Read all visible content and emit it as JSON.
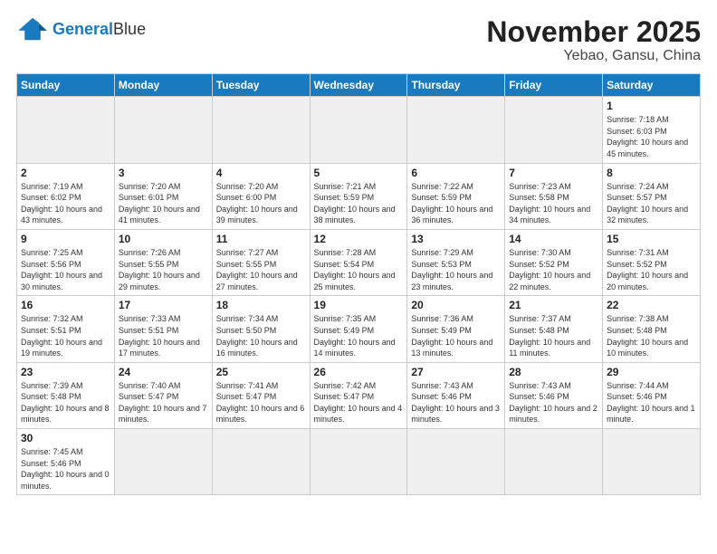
{
  "header": {
    "logo_general": "General",
    "logo_blue": "Blue",
    "month_title": "November 2025",
    "location": "Yebao, Gansu, China"
  },
  "days_of_week": [
    "Sunday",
    "Monday",
    "Tuesday",
    "Wednesday",
    "Thursday",
    "Friday",
    "Saturday"
  ],
  "weeks": [
    [
      {
        "day": "",
        "empty": true
      },
      {
        "day": "",
        "empty": true
      },
      {
        "day": "",
        "empty": true
      },
      {
        "day": "",
        "empty": true
      },
      {
        "day": "",
        "empty": true
      },
      {
        "day": "",
        "empty": true
      },
      {
        "day": "1",
        "sunrise": "7:18 AM",
        "sunset": "6:03 PM",
        "daylight": "10 hours and 45 minutes."
      }
    ],
    [
      {
        "day": "2",
        "sunrise": "7:19 AM",
        "sunset": "6:02 PM",
        "daylight": "10 hours and 43 minutes."
      },
      {
        "day": "3",
        "sunrise": "7:20 AM",
        "sunset": "6:01 PM",
        "daylight": "10 hours and 41 minutes."
      },
      {
        "day": "4",
        "sunrise": "7:20 AM",
        "sunset": "6:00 PM",
        "daylight": "10 hours and 39 minutes."
      },
      {
        "day": "5",
        "sunrise": "7:21 AM",
        "sunset": "5:59 PM",
        "daylight": "10 hours and 38 minutes."
      },
      {
        "day": "6",
        "sunrise": "7:22 AM",
        "sunset": "5:59 PM",
        "daylight": "10 hours and 36 minutes."
      },
      {
        "day": "7",
        "sunrise": "7:23 AM",
        "sunset": "5:58 PM",
        "daylight": "10 hours and 34 minutes."
      },
      {
        "day": "8",
        "sunrise": "7:24 AM",
        "sunset": "5:57 PM",
        "daylight": "10 hours and 32 minutes."
      }
    ],
    [
      {
        "day": "9",
        "sunrise": "7:25 AM",
        "sunset": "5:56 PM",
        "daylight": "10 hours and 30 minutes."
      },
      {
        "day": "10",
        "sunrise": "7:26 AM",
        "sunset": "5:55 PM",
        "daylight": "10 hours and 29 minutes."
      },
      {
        "day": "11",
        "sunrise": "7:27 AM",
        "sunset": "5:55 PM",
        "daylight": "10 hours and 27 minutes."
      },
      {
        "day": "12",
        "sunrise": "7:28 AM",
        "sunset": "5:54 PM",
        "daylight": "10 hours and 25 minutes."
      },
      {
        "day": "13",
        "sunrise": "7:29 AM",
        "sunset": "5:53 PM",
        "daylight": "10 hours and 23 minutes."
      },
      {
        "day": "14",
        "sunrise": "7:30 AM",
        "sunset": "5:52 PM",
        "daylight": "10 hours and 22 minutes."
      },
      {
        "day": "15",
        "sunrise": "7:31 AM",
        "sunset": "5:52 PM",
        "daylight": "10 hours and 20 minutes."
      }
    ],
    [
      {
        "day": "16",
        "sunrise": "7:32 AM",
        "sunset": "5:51 PM",
        "daylight": "10 hours and 19 minutes."
      },
      {
        "day": "17",
        "sunrise": "7:33 AM",
        "sunset": "5:51 PM",
        "daylight": "10 hours and 17 minutes."
      },
      {
        "day": "18",
        "sunrise": "7:34 AM",
        "sunset": "5:50 PM",
        "daylight": "10 hours and 16 minutes."
      },
      {
        "day": "19",
        "sunrise": "7:35 AM",
        "sunset": "5:49 PM",
        "daylight": "10 hours and 14 minutes."
      },
      {
        "day": "20",
        "sunrise": "7:36 AM",
        "sunset": "5:49 PM",
        "daylight": "10 hours and 13 minutes."
      },
      {
        "day": "21",
        "sunrise": "7:37 AM",
        "sunset": "5:48 PM",
        "daylight": "10 hours and 11 minutes."
      },
      {
        "day": "22",
        "sunrise": "7:38 AM",
        "sunset": "5:48 PM",
        "daylight": "10 hours and 10 minutes."
      }
    ],
    [
      {
        "day": "23",
        "sunrise": "7:39 AM",
        "sunset": "5:48 PM",
        "daylight": "10 hours and 8 minutes."
      },
      {
        "day": "24",
        "sunrise": "7:40 AM",
        "sunset": "5:47 PM",
        "daylight": "10 hours and 7 minutes."
      },
      {
        "day": "25",
        "sunrise": "7:41 AM",
        "sunset": "5:47 PM",
        "daylight": "10 hours and 6 minutes."
      },
      {
        "day": "26",
        "sunrise": "7:42 AM",
        "sunset": "5:47 PM",
        "daylight": "10 hours and 4 minutes."
      },
      {
        "day": "27",
        "sunrise": "7:43 AM",
        "sunset": "5:46 PM",
        "daylight": "10 hours and 3 minutes."
      },
      {
        "day": "28",
        "sunrise": "7:43 AM",
        "sunset": "5:46 PM",
        "daylight": "10 hours and 2 minutes."
      },
      {
        "day": "29",
        "sunrise": "7:44 AM",
        "sunset": "5:46 PM",
        "daylight": "10 hours and 1 minute."
      }
    ],
    [
      {
        "day": "30",
        "sunrise": "7:45 AM",
        "sunset": "5:46 PM",
        "daylight": "10 hours and 0 minutes."
      },
      {
        "day": "",
        "empty": true
      },
      {
        "day": "",
        "empty": true
      },
      {
        "day": "",
        "empty": true
      },
      {
        "day": "",
        "empty": true
      },
      {
        "day": "",
        "empty": true
      },
      {
        "day": "",
        "empty": true
      }
    ]
  ]
}
